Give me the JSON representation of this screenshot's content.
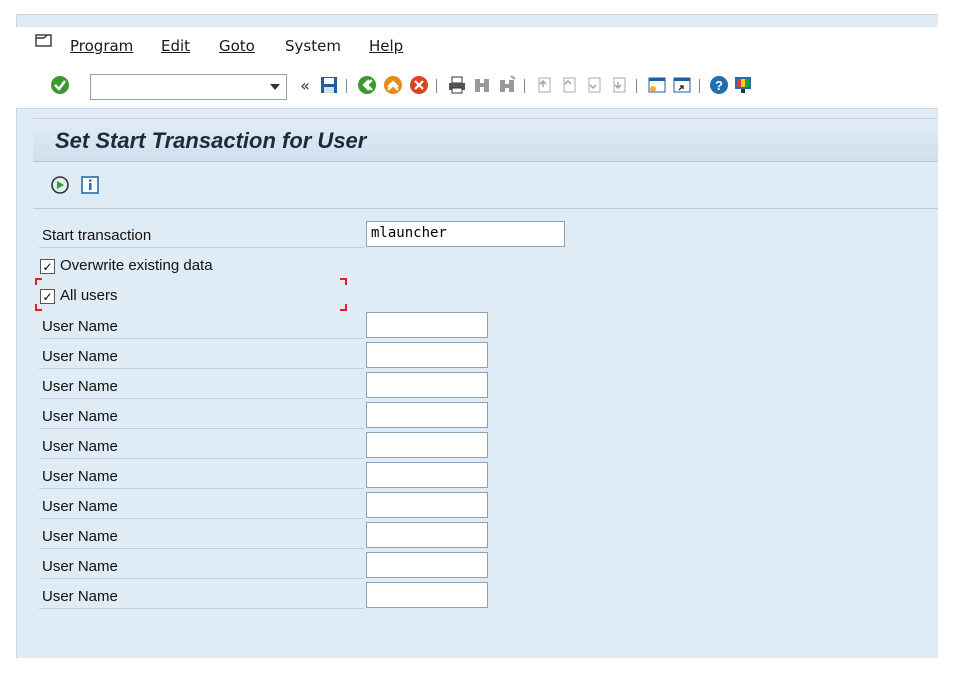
{
  "menu": {
    "items": [
      {
        "key": "P",
        "rest": "rogram"
      },
      {
        "key": "E",
        "rest": "dit"
      },
      {
        "key": "G",
        "rest": "oto"
      },
      {
        "key": "S",
        "mid_before": "S",
        "label": "System"
      },
      {
        "key": "H",
        "rest": "elp"
      }
    ],
    "program": "Program",
    "edit": "Edit",
    "goto": "Goto",
    "system": "System",
    "help": "Help"
  },
  "toolbar": {
    "command_value": "",
    "icons": [
      "enter-icon",
      "command-dropdown-icon",
      "collapse-icon",
      "save-icon",
      "back-icon",
      "exit-icon",
      "cancel-icon",
      "print-icon",
      "find-icon",
      "find-next-icon",
      "first-page-icon",
      "previous-page-icon",
      "next-page-icon",
      "last-page-icon",
      "create-session-icon",
      "shortcut-icon",
      "help-icon",
      "customize-layout-icon"
    ]
  },
  "page": {
    "title": "Set Start Transaction for User"
  },
  "app_toolbar": {
    "icons": [
      "execute-icon",
      "info-icon"
    ]
  },
  "form": {
    "start_transaction_label": "Start transaction",
    "start_transaction_value": "mlauncher",
    "overwrite_label": "Overwrite existing data",
    "overwrite_checked": true,
    "all_users_label": "All users",
    "all_users_checked": true,
    "user_rows": [
      {
        "label": "User Name",
        "value": ""
      },
      {
        "label": "User Name",
        "value": ""
      },
      {
        "label": "User Name",
        "value": ""
      },
      {
        "label": "User Name",
        "value": ""
      },
      {
        "label": "User Name",
        "value": ""
      },
      {
        "label": "User Name",
        "value": ""
      },
      {
        "label": "User Name",
        "value": ""
      },
      {
        "label": "User Name",
        "value": ""
      },
      {
        "label": "User Name",
        "value": ""
      },
      {
        "label": "User Name",
        "value": ""
      }
    ]
  },
  "colors": {
    "background": "#dfebf5",
    "enter_green": "#3a9a2f",
    "exit_orange": "#e88a1a",
    "cancel_red": "#d9451f",
    "help_blue": "#1f6fb2",
    "save_blue": "#1f5fa0"
  }
}
